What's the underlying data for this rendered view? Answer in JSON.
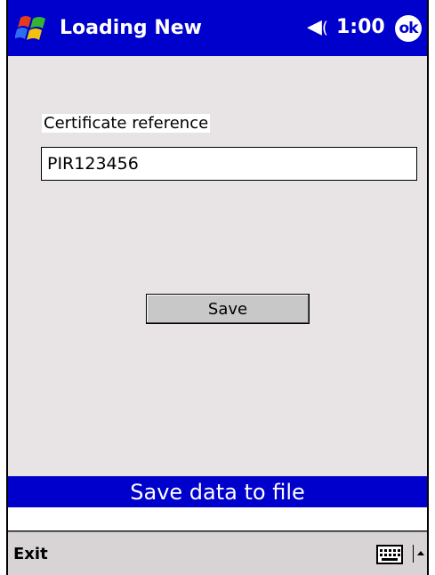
{
  "title_bar": {
    "title": "Loading New",
    "time": "1:00",
    "ok_label": "ok"
  },
  "form": {
    "cert_label": "Certificate reference",
    "cert_value": "PIR123456",
    "save_label": "Save"
  },
  "status": {
    "text": "Save data to file"
  },
  "menu": {
    "exit_label": "Exit"
  },
  "icons": {
    "start": "windows-flag-icon",
    "speaker": "speaker-icon",
    "keyboard": "keyboard-icon",
    "arrow": "up-arrow-icon"
  },
  "colors": {
    "title_bar": "#0000cc",
    "status_bar": "#0000cc",
    "background": "#e8e4e6"
  }
}
